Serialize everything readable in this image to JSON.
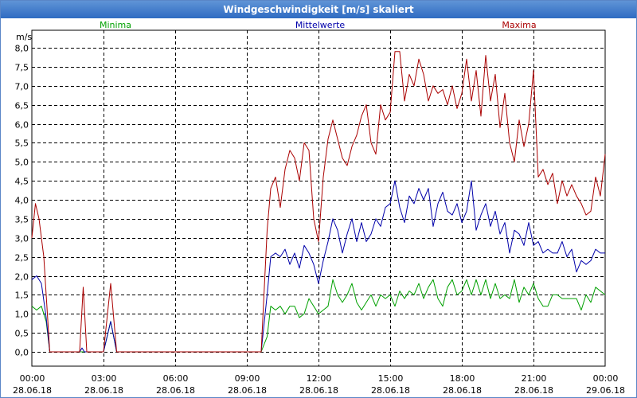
{
  "window": {
    "title": "Windgeschwindigkeit [m/s] skaliert"
  },
  "colors": {
    "minima": "#00a000",
    "mittelwerte": "#0000aa",
    "maxima": "#aa0000",
    "grid": "#000000",
    "title_bar": "#3a74c8"
  },
  "chart_data": {
    "type": "line",
    "title": "Windgeschwindigkeit [m/s] skaliert",
    "ylabel": "m/s",
    "xlabel": "",
    "ylim": [
      0,
      8
    ],
    "xlim_hours": [
      0,
      24
    ],
    "grid": true,
    "legend_placement": "top",
    "y_ticks": [
      "0,0",
      "0,5",
      "1,0",
      "1,5",
      "2,0",
      "2,5",
      "3,0",
      "3,5",
      "4,0",
      "4,5",
      "5,0",
      "5,5",
      "6,0",
      "6,5",
      "7,0",
      "7,5",
      "8,0"
    ],
    "x_ticks": [
      {
        "time": "00:00",
        "date": "28.06.18"
      },
      {
        "time": "03:00",
        "date": "28.06.18"
      },
      {
        "time": "06:00",
        "date": "28.06.18"
      },
      {
        "time": "09:00",
        "date": "28.06.18"
      },
      {
        "time": "12:00",
        "date": "28.06.18"
      },
      {
        "time": "15:00",
        "date": "28.06.18"
      },
      {
        "time": "18:00",
        "date": "28.06.18"
      },
      {
        "time": "21:00",
        "date": "28.06.18"
      },
      {
        "time": "00:00",
        "date": "29.06.18"
      }
    ],
    "series": [
      {
        "name": "Minima",
        "color": "#00a000",
        "points": [
          [
            0,
            1.2
          ],
          [
            0.2,
            1.1
          ],
          [
            0.4,
            1.2
          ],
          [
            0.6,
            0.8
          ],
          [
            0.75,
            0
          ],
          [
            2,
            0
          ],
          [
            2.1,
            0
          ],
          [
            2.2,
            0
          ],
          [
            3,
            0
          ],
          [
            3.3,
            0.8
          ],
          [
            3.55,
            0
          ],
          [
            9.6,
            0
          ],
          [
            9.85,
            0.4
          ],
          [
            10,
            1.2
          ],
          [
            10.2,
            1.1
          ],
          [
            10.4,
            1.2
          ],
          [
            10.6,
            1.0
          ],
          [
            10.8,
            1.2
          ],
          [
            11,
            1.2
          ],
          [
            11.2,
            0.9
          ],
          [
            11.4,
            1.0
          ],
          [
            11.6,
            1.4
          ],
          [
            11.8,
            1.2
          ],
          [
            12,
            1.0
          ],
          [
            12.2,
            1.1
          ],
          [
            12.4,
            1.2
          ],
          [
            12.6,
            1.9
          ],
          [
            12.8,
            1.5
          ],
          [
            13,
            1.3
          ],
          [
            13.2,
            1.5
          ],
          [
            13.4,
            1.8
          ],
          [
            13.6,
            1.3
          ],
          [
            13.8,
            1.1
          ],
          [
            14,
            1.3
          ],
          [
            14.2,
            1.5
          ],
          [
            14.4,
            1.2
          ],
          [
            14.6,
            1.5
          ],
          [
            14.8,
            1.4
          ],
          [
            15,
            1.5
          ],
          [
            15.2,
            1.2
          ],
          [
            15.4,
            1.6
          ],
          [
            15.6,
            1.4
          ],
          [
            15.8,
            1.6
          ],
          [
            16,
            1.5
          ],
          [
            16.2,
            1.8
          ],
          [
            16.4,
            1.4
          ],
          [
            16.6,
            1.7
          ],
          [
            16.8,
            1.9
          ],
          [
            17,
            1.4
          ],
          [
            17.2,
            1.2
          ],
          [
            17.4,
            1.7
          ],
          [
            17.6,
            1.9
          ],
          [
            17.8,
            1.5
          ],
          [
            18,
            1.6
          ],
          [
            18.2,
            1.9
          ],
          [
            18.4,
            1.5
          ],
          [
            18.6,
            1.9
          ],
          [
            18.8,
            1.5
          ],
          [
            19,
            1.9
          ],
          [
            19.2,
            1.4
          ],
          [
            19.4,
            1.8
          ],
          [
            19.6,
            1.4
          ],
          [
            19.8,
            1.5
          ],
          [
            20,
            1.4
          ],
          [
            20.2,
            1.9
          ],
          [
            20.4,
            1.3
          ],
          [
            20.6,
            1.7
          ],
          [
            20.8,
            1.5
          ],
          [
            21,
            1.8
          ],
          [
            21.2,
            1.4
          ],
          [
            21.4,
            1.2
          ],
          [
            21.6,
            1.2
          ],
          [
            21.8,
            1.5
          ],
          [
            22,
            1.5
          ],
          [
            22.2,
            1.4
          ],
          [
            22.4,
            1.4
          ],
          [
            22.6,
            1.4
          ],
          [
            22.8,
            1.4
          ],
          [
            23,
            1.1
          ],
          [
            23.2,
            1.5
          ],
          [
            23.4,
            1.3
          ],
          [
            23.6,
            1.7
          ],
          [
            23.8,
            1.6
          ],
          [
            24,
            1.5
          ]
        ]
      },
      {
        "name": "Mittelwerte",
        "color": "#0000aa",
        "points": [
          [
            0,
            1.9
          ],
          [
            0.2,
            2.0
          ],
          [
            0.4,
            1.8
          ],
          [
            0.6,
            0.9
          ],
          [
            0.75,
            0
          ],
          [
            2,
            0
          ],
          [
            2.1,
            0.1
          ],
          [
            2.2,
            0
          ],
          [
            3,
            0
          ],
          [
            3.3,
            0.8
          ],
          [
            3.55,
            0
          ],
          [
            9.6,
            0
          ],
          [
            9.85,
            1.5
          ],
          [
            10,
            2.5
          ],
          [
            10.2,
            2.6
          ],
          [
            10.4,
            2.5
          ],
          [
            10.6,
            2.7
          ],
          [
            10.8,
            2.3
          ],
          [
            11,
            2.6
          ],
          [
            11.2,
            2.2
          ],
          [
            11.4,
            2.8
          ],
          [
            11.6,
            2.6
          ],
          [
            11.8,
            2.3
          ],
          [
            12,
            1.8
          ],
          [
            12.2,
            2.4
          ],
          [
            12.4,
            2.9
          ],
          [
            12.6,
            3.5
          ],
          [
            12.8,
            3.2
          ],
          [
            13,
            2.6
          ],
          [
            13.2,
            3.1
          ],
          [
            13.4,
            3.5
          ],
          [
            13.6,
            2.9
          ],
          [
            13.8,
            3.4
          ],
          [
            14,
            2.9
          ],
          [
            14.2,
            3.1
          ],
          [
            14.4,
            3.5
          ],
          [
            14.6,
            3.3
          ],
          [
            14.8,
            3.8
          ],
          [
            15,
            3.9
          ],
          [
            15.2,
            4.5
          ],
          [
            15.4,
            3.8
          ],
          [
            15.6,
            3.4
          ],
          [
            15.8,
            4.1
          ],
          [
            16,
            3.9
          ],
          [
            16.2,
            4.3
          ],
          [
            16.4,
            4.0
          ],
          [
            16.6,
            4.3
          ],
          [
            16.8,
            3.3
          ],
          [
            17,
            3.9
          ],
          [
            17.2,
            4.2
          ],
          [
            17.4,
            3.7
          ],
          [
            17.6,
            3.6
          ],
          [
            17.8,
            3.9
          ],
          [
            18,
            3.4
          ],
          [
            18.2,
            3.7
          ],
          [
            18.4,
            4.5
          ],
          [
            18.6,
            3.2
          ],
          [
            18.8,
            3.6
          ],
          [
            19,
            3.9
          ],
          [
            19.2,
            3.3
          ],
          [
            19.4,
            3.7
          ],
          [
            19.6,
            3.1
          ],
          [
            19.8,
            3.4
          ],
          [
            20,
            2.6
          ],
          [
            20.2,
            3.2
          ],
          [
            20.4,
            3.1
          ],
          [
            20.6,
            2.8
          ],
          [
            20.8,
            3.4
          ],
          [
            21,
            2.8
          ],
          [
            21.2,
            2.9
          ],
          [
            21.4,
            2.6
          ],
          [
            21.6,
            2.7
          ],
          [
            21.8,
            2.6
          ],
          [
            22,
            2.6
          ],
          [
            22.2,
            2.9
          ],
          [
            22.4,
            2.5
          ],
          [
            22.6,
            2.7
          ],
          [
            22.8,
            2.1
          ],
          [
            23,
            2.4
          ],
          [
            23.2,
            2.3
          ],
          [
            23.4,
            2.4
          ],
          [
            23.6,
            2.7
          ],
          [
            23.8,
            2.6
          ],
          [
            24,
            2.6
          ]
        ]
      },
      {
        "name": "Maxima",
        "color": "#aa0000",
        "points": [
          [
            0,
            3.0
          ],
          [
            0.15,
            3.9
          ],
          [
            0.3,
            3.5
          ],
          [
            0.5,
            2.5
          ],
          [
            0.75,
            0
          ],
          [
            2,
            0
          ],
          [
            2.15,
            1.7
          ],
          [
            2.3,
            0
          ],
          [
            3,
            0
          ],
          [
            3.3,
            1.8
          ],
          [
            3.55,
            0
          ],
          [
            9.6,
            0
          ],
          [
            9.85,
            3.2
          ],
          [
            10,
            4.3
          ],
          [
            10.2,
            4.6
          ],
          [
            10.4,
            3.8
          ],
          [
            10.6,
            4.8
          ],
          [
            10.8,
            5.3
          ],
          [
            11,
            5.1
          ],
          [
            11.2,
            4.5
          ],
          [
            11.4,
            5.5
          ],
          [
            11.6,
            5.3
          ],
          [
            11.8,
            3.5
          ],
          [
            12,
            2.9
          ],
          [
            12.2,
            4.6
          ],
          [
            12.4,
            5.6
          ],
          [
            12.6,
            6.1
          ],
          [
            12.8,
            5.6
          ],
          [
            13,
            5.1
          ],
          [
            13.2,
            4.9
          ],
          [
            13.4,
            5.4
          ],
          [
            13.6,
            5.7
          ],
          [
            13.8,
            6.2
          ],
          [
            14,
            6.5
          ],
          [
            14.2,
            5.5
          ],
          [
            14.4,
            5.2
          ],
          [
            14.6,
            6.5
          ],
          [
            14.8,
            6.1
          ],
          [
            15,
            6.3
          ],
          [
            15.2,
            7.9
          ],
          [
            15.4,
            7.9
          ],
          [
            15.6,
            6.6
          ],
          [
            15.8,
            7.3
          ],
          [
            16,
            7.0
          ],
          [
            16.2,
            7.7
          ],
          [
            16.4,
            7.3
          ],
          [
            16.6,
            6.6
          ],
          [
            16.8,
            7.0
          ],
          [
            17,
            6.8
          ],
          [
            17.2,
            6.9
          ],
          [
            17.4,
            6.5
          ],
          [
            17.6,
            7.0
          ],
          [
            17.8,
            6.4
          ],
          [
            18,
            6.8
          ],
          [
            18.2,
            7.7
          ],
          [
            18.4,
            6.6
          ],
          [
            18.6,
            7.4
          ],
          [
            18.8,
            6.2
          ],
          [
            19,
            7.8
          ],
          [
            19.2,
            6.6
          ],
          [
            19.4,
            7.3
          ],
          [
            19.6,
            5.9
          ],
          [
            19.8,
            6.8
          ],
          [
            20,
            5.5
          ],
          [
            20.2,
            5.0
          ],
          [
            20.4,
            6.1
          ],
          [
            20.6,
            5.4
          ],
          [
            20.8,
            6.0
          ],
          [
            21,
            7.4
          ],
          [
            21.2,
            4.6
          ],
          [
            21.4,
            4.8
          ],
          [
            21.6,
            4.4
          ],
          [
            21.8,
            4.7
          ],
          [
            22,
            3.9
          ],
          [
            22.2,
            4.5
          ],
          [
            22.4,
            4.1
          ],
          [
            22.6,
            4.4
          ],
          [
            22.8,
            4.1
          ],
          [
            23,
            3.9
          ],
          [
            23.2,
            3.6
          ],
          [
            23.4,
            3.7
          ],
          [
            23.6,
            4.6
          ],
          [
            23.8,
            4.1
          ],
          [
            24,
            5.2
          ]
        ]
      }
    ]
  }
}
